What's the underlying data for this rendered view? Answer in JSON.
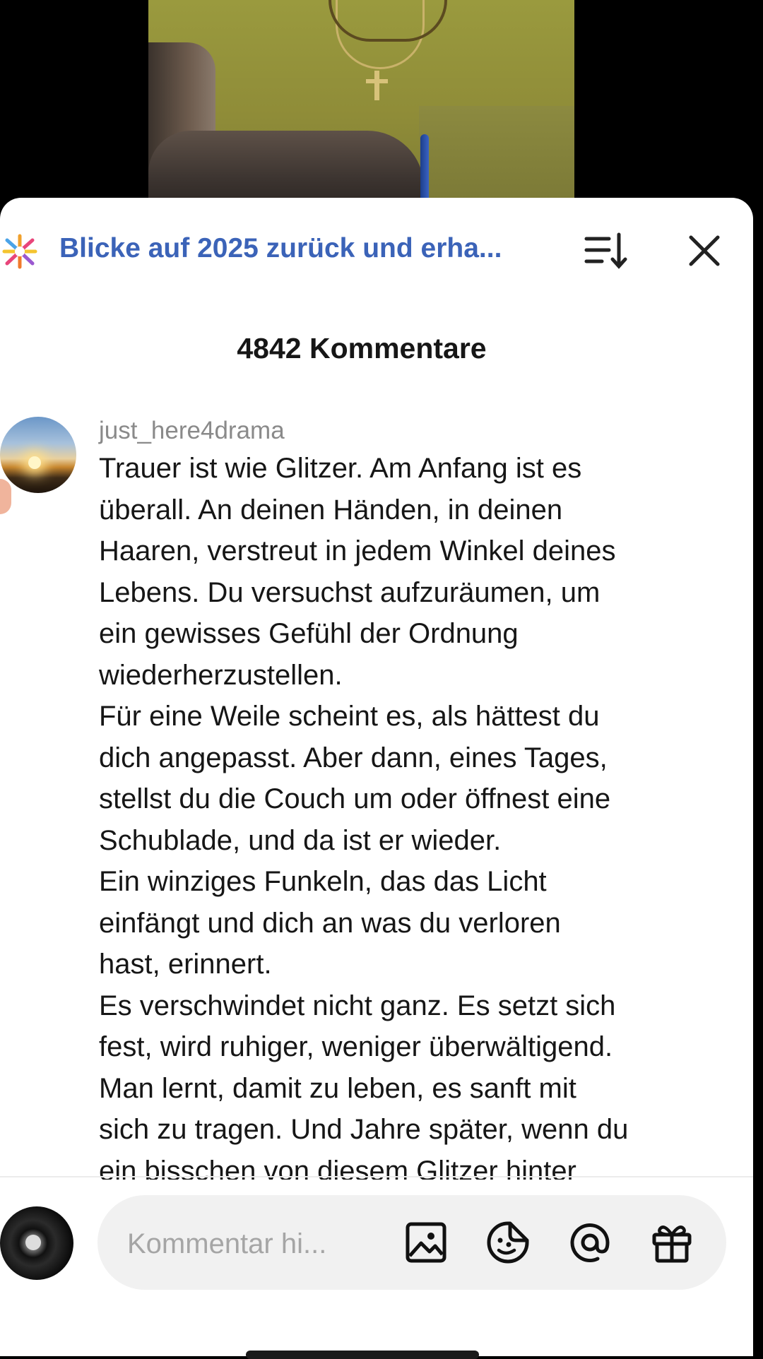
{
  "promo": {
    "title": "Blicke auf 2025 zurück und erha...",
    "icon": "confetti-burst-icon"
  },
  "header": {
    "sort_icon": "sort-descending-icon",
    "close_icon": "close-icon",
    "comments_count": "4842 Kommentare"
  },
  "comment": {
    "username": "just_here4drama",
    "text": "Trauer ist wie Glitzer. Am Anfang ist es\nüberall. An deinen Händen, in deinen\nHaaren, verstreut in jedem Winkel deines\nLebens. Du versuchst aufzuräumen, um\nein gewisses Gefühl der Ordnung\nwiederherzustellen.\nFür eine Weile scheint es, als hättest du\ndich angepasst. Aber dann, eines Tages,\nstellst du die Couch um oder öffnest eine\nSchublade, und da ist er wieder.\nEin winziges Funkeln, das das Licht\neinfängt und dich an was du verloren\nhast, erinnert.\nEs verschwindet nicht ganz. Es setzt sich\nfest, wird ruhiger, weniger überwältigend.\nMan lernt, damit zu leben, es sanft mit\nsich zu tragen. Und Jahre später, wenn du\nein bisschen von diesem Glitzer hinter"
  },
  "composer": {
    "placeholder": "Kommentar hi...",
    "icons": [
      "image-icon",
      "sticker-icon",
      "mention-icon",
      "gift-icon"
    ]
  },
  "colors": {
    "accent": "#3b63b8",
    "sheet": "#ffffff",
    "input_bg": "#f1f1f1"
  }
}
